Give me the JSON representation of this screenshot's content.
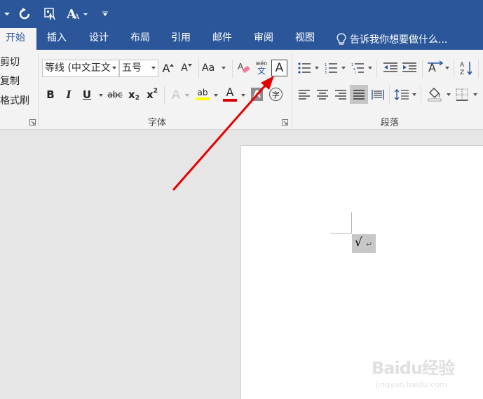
{
  "tabs": [
    {
      "label": "开始",
      "active": true
    },
    {
      "label": "插入"
    },
    {
      "label": "设计"
    },
    {
      "label": "布局"
    },
    {
      "label": "引用"
    },
    {
      "label": "邮件"
    },
    {
      "label": "审阅"
    },
    {
      "label": "视图"
    }
  ],
  "tell_me": "告诉我你想要做什么...",
  "clipboard": {
    "cut": "剪切",
    "copy": "复制",
    "format_painter": "格式刷"
  },
  "font_group": {
    "label": "字体",
    "font_name": "等线 (中文正文",
    "font_size": "五号",
    "grow": "A",
    "shrink": "A",
    "change_case": "Aa",
    "phonetic_top": "wén",
    "phonetic_bottom": "文",
    "char_border": "A",
    "bold": "B",
    "italic": "I",
    "underline": "U",
    "strikethrough": "abc",
    "subscript": "x",
    "subscript_2": "2",
    "superscript": "x",
    "superscript_2": "2",
    "text_effects": "A",
    "highlight": "ab",
    "font_color": "A",
    "char_shading": "A",
    "enclose": "字"
  },
  "paragraph_group": {
    "label": "段落"
  },
  "document": {
    "content": "√",
    "para_mark": "↵"
  },
  "watermark": {
    "logo": "Baidu经验",
    "url": "jingyan.baidu.com"
  },
  "colors": {
    "ribbon_blue": "#2b579a",
    "highlight_yellow": "#ffff00",
    "font_red": "#e00000",
    "arrow_red": "#e60000"
  }
}
